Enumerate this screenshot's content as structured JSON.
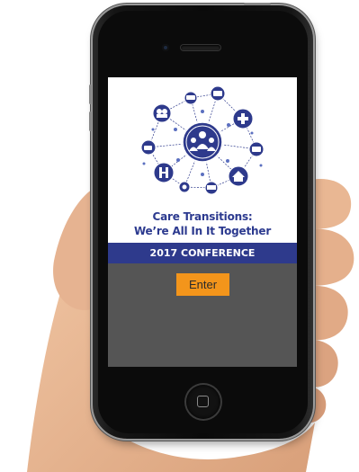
{
  "app": {
    "title_line1": "Care Transitions:",
    "title_line2": "We’re All In It Together",
    "banner": "2017 CONFERENCE",
    "enter_label": "Enter"
  },
  "colors": {
    "brand_blue": "#2e3a8c",
    "accent_orange": "#f3951b",
    "screen_gray": "#555555"
  },
  "icons": [
    "people-group-icon",
    "family-icon",
    "ambulance-icon",
    "pharmacy-icon",
    "medical-cross-icon",
    "home-care-icon",
    "nurse-icon",
    "hospital-icon",
    "wheelchair-icon",
    "bed-icon",
    "house-icon"
  ]
}
